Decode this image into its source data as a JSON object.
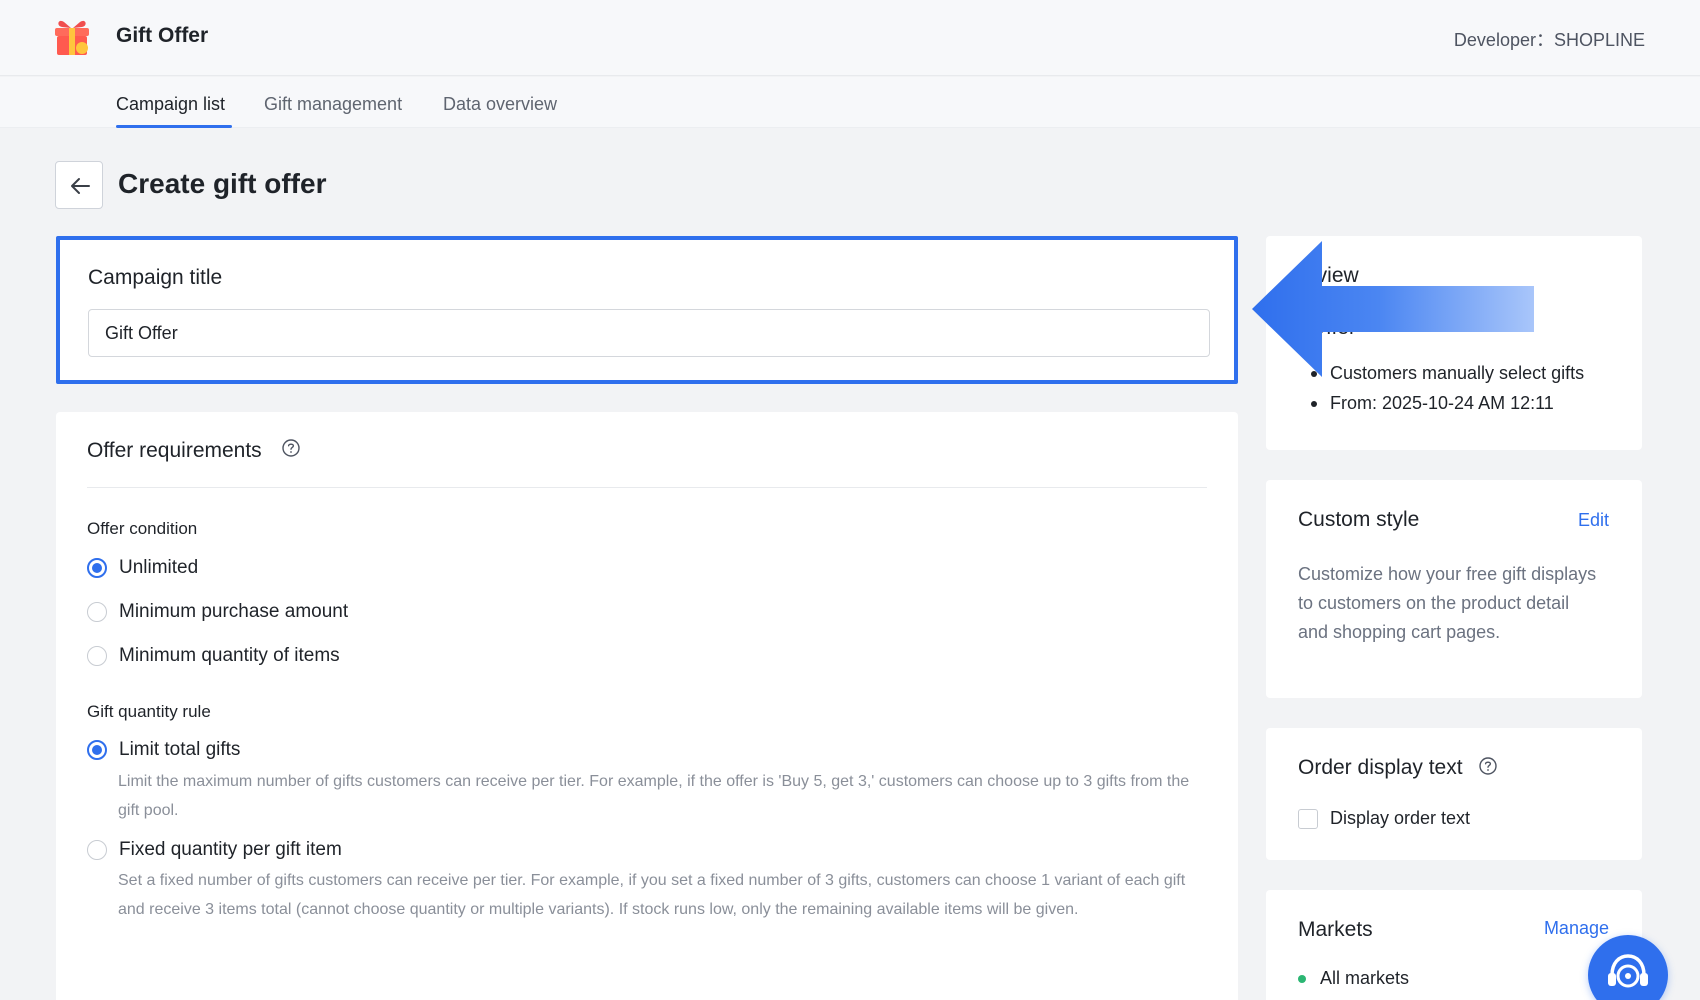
{
  "app": {
    "name": "Gift Offer",
    "developer": "Developer：SHOPLINE",
    "logo_icon": "gift-box-icon"
  },
  "tabs": [
    {
      "label": "Campaign list",
      "active": true
    },
    {
      "label": "Gift management",
      "active": false
    },
    {
      "label": "Data overview",
      "active": false
    }
  ],
  "page": {
    "title": "Create gift offer",
    "back_icon": "arrow-left-icon"
  },
  "campaign": {
    "label": "Campaign title",
    "value": "Gift Offer"
  },
  "requirements": {
    "title": "Offer requirements",
    "condition_label": "Offer condition",
    "conditions": [
      {
        "label": "Unlimited",
        "selected": true
      },
      {
        "label": "Minimum purchase amount",
        "selected": false
      },
      {
        "label": "Minimum quantity of items",
        "selected": false
      }
    ],
    "rule_label": "Gift quantity rule",
    "rules": [
      {
        "label": "Limit total gifts",
        "selected": true,
        "description": "Limit the maximum number of gifts customers can receive per tier. For example, if the offer is 'Buy 5, get 3,' customers can choose up to 3 gifts from the gift pool."
      },
      {
        "label": "Fixed quantity per gift item",
        "selected": false,
        "description": "Set a fixed number of gifts customers can receive per tier. For example, if you set a fixed number of 3 gifts, customers can choose 1 variant of each gift and receive 3 items total (cannot choose quantity or multiple variants). If stock runs low, only the remaining available items will be given."
      }
    ]
  },
  "overview": {
    "title_visible": "erview",
    "name_visible": "t Offer",
    "items": [
      "Customers manually select gifts",
      "From: 2025-10-24 AM 12:11"
    ]
  },
  "custom_style": {
    "title": "Custom style",
    "link": "Edit",
    "description": "Customize how your free gift displays to customers on the product detail and shopping cart pages."
  },
  "order_display": {
    "title": "Order display text",
    "checkbox_label": "Display order text",
    "checked": false
  },
  "markets": {
    "title": "Markets",
    "link": "Manage",
    "items": [
      "All markets"
    ]
  },
  "colors": {
    "accent": "#2f6fed",
    "highlight_border": "#2f6fed",
    "market_status": "#2bb673"
  },
  "support_icon": "headset-support-icon"
}
